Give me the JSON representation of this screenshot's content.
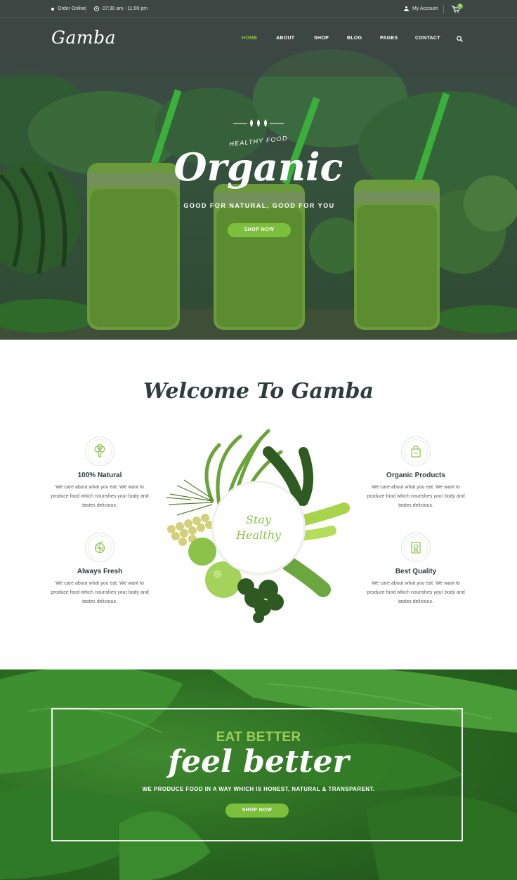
{
  "topbar": {
    "order": "Order Online",
    "hours": "07:30 am - 11:00 pm",
    "account": "My Account",
    "cart_count": "0"
  },
  "nav": {
    "logo": "Gamba",
    "items": [
      "HOME",
      "ABOUT",
      "SHOP",
      "BLOG",
      "PAGES",
      "CONTACT"
    ],
    "active": "HOME"
  },
  "hero": {
    "kicker": "HEALTHY FOOD",
    "title": "Organic",
    "subtitle": "GOOD FOR NATURAL, GOOD FOR YOU",
    "button": "SHOP NOW"
  },
  "welcome": {
    "title": "Welcome To Gamba",
    "plate_line1": "Stay",
    "plate_line2": "Healthy",
    "features": [
      {
        "title": "100% Natural",
        "text": "We care about what you eat. We want to produce food which nourishes your body and tastes delicious.",
        "icon": "broccoli-icon"
      },
      {
        "title": "Always Fresh",
        "text": "We care about what you eat. We want to produce food which nourishes your body and tastes delicious.",
        "icon": "citrus-icon"
      },
      {
        "title": "Organic Products",
        "text": "We care about what you eat. We want to produce food which nourishes your body and tastes delicious.",
        "icon": "grocery-bag-icon"
      },
      {
        "title": "Best Quality",
        "text": "We care about what you eat. We want to produce food which nourishes your body and tastes delicious.",
        "icon": "quality-badge-icon"
      }
    ]
  },
  "banner": {
    "kicker": "EAT BETTER",
    "title": "feel better",
    "subtitle": "WE PRODUCE FOOD IN A WAY WHICH IS HONEST, NATURAL & TRANSPARENT.",
    "button": "SHOP NOW"
  },
  "colors": {
    "accent": "#7cbf3c",
    "accent_text": "#8bc34a",
    "dark_text": "#2e3c3a"
  }
}
